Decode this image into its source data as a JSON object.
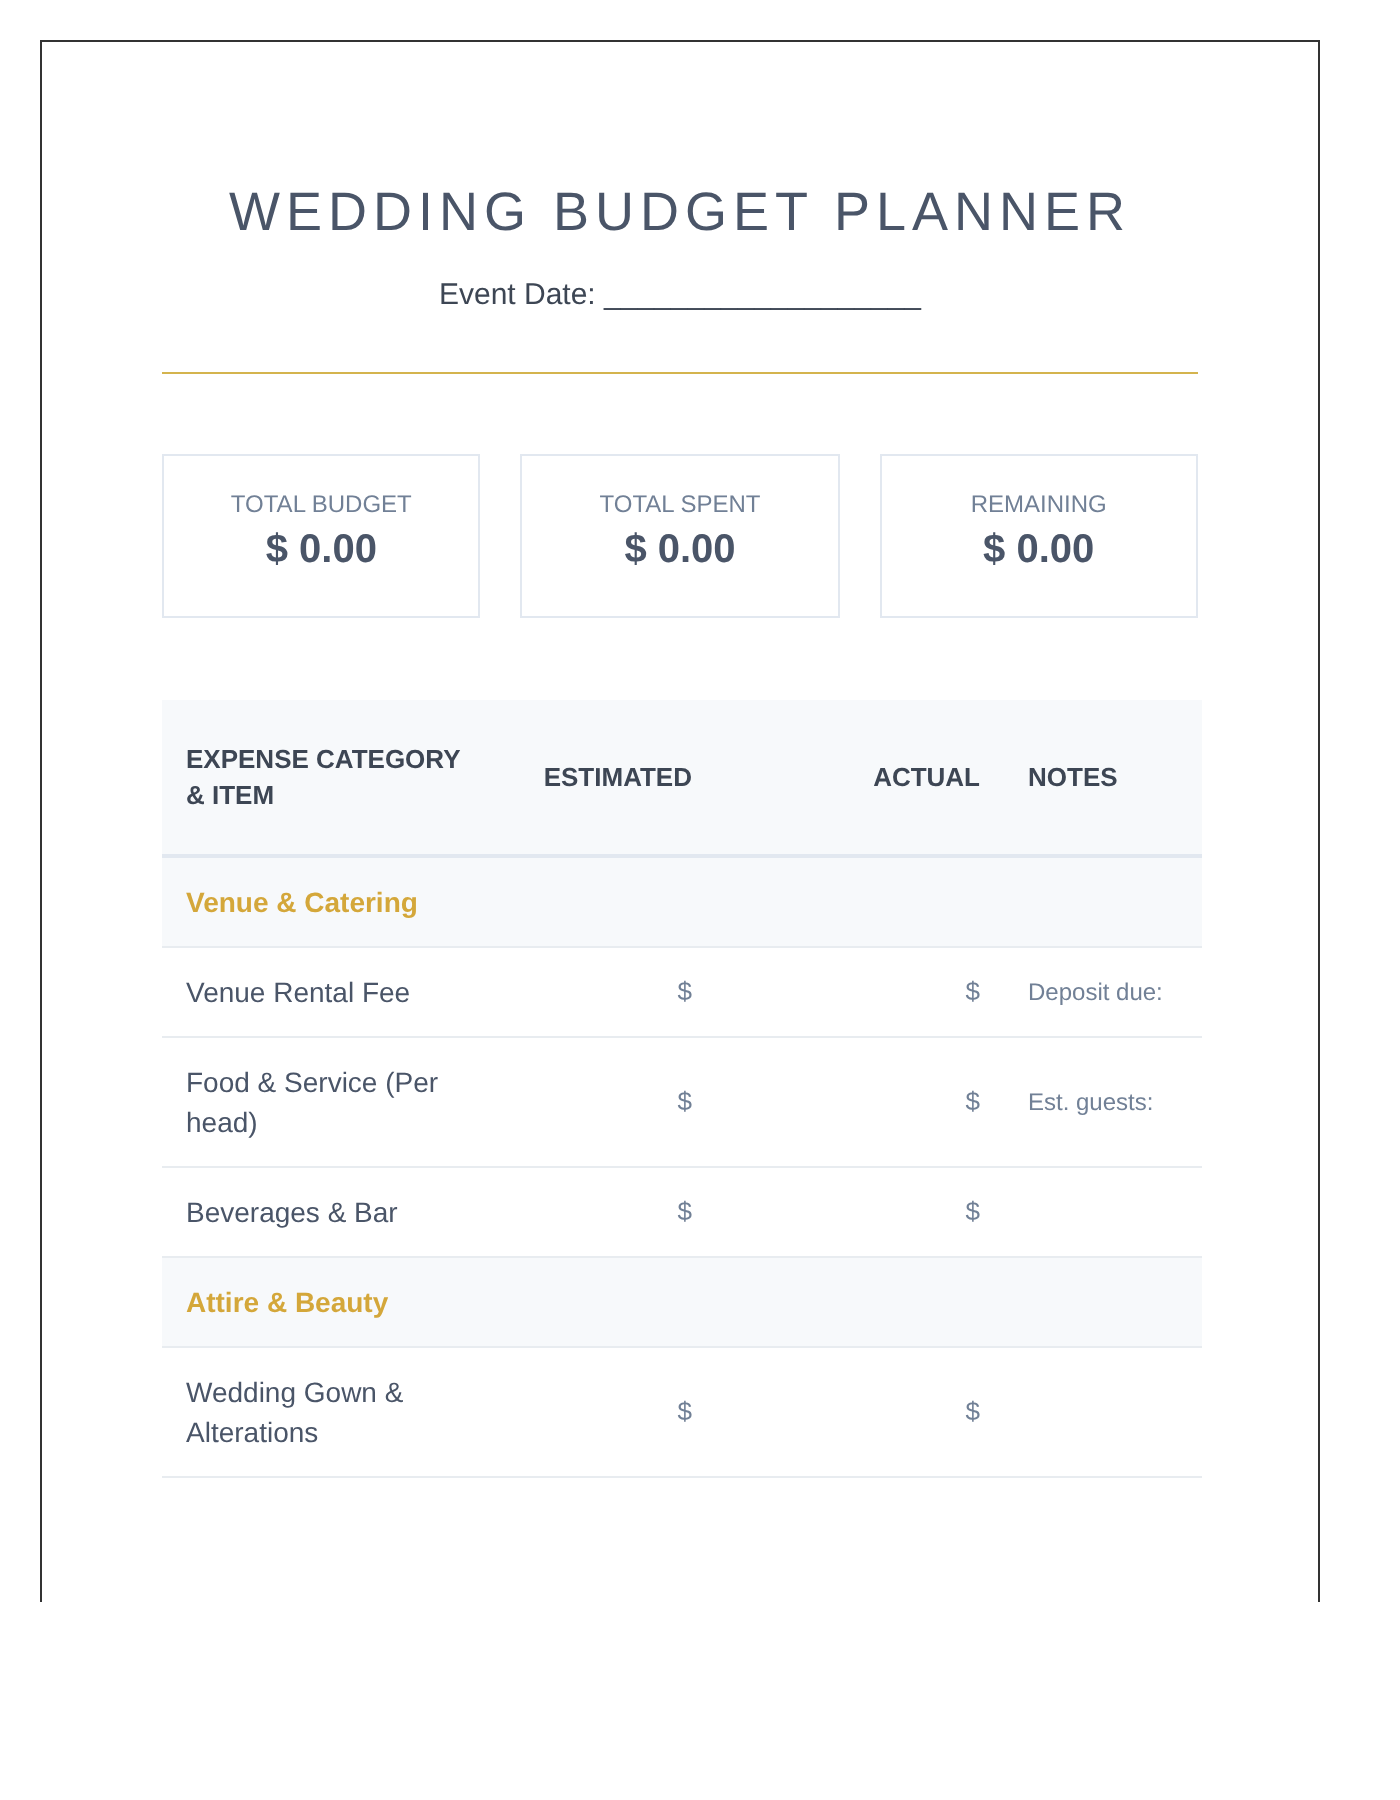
{
  "title": "WEDDING BUDGET PLANNER",
  "event_date": "Event Date: ___________________",
  "summary": [
    {
      "label": "TOTAL BUDGET",
      "value": "$ 0.00"
    },
    {
      "label": "TOTAL SPENT",
      "value": "$ 0.00"
    },
    {
      "label": "REMAINING",
      "value": "$ 0.00"
    }
  ],
  "table": {
    "columns": [
      "EXPENSE CATEGORY & ITEM",
      "ESTIMATED",
      "ACTUAL",
      "NOTES"
    ],
    "rows": [
      {
        "kind": "category",
        "label": "Venue & Catering"
      },
      {
        "kind": "item",
        "label": "Venue Rental Fee",
        "estimated": "$",
        "actual": "$",
        "notes": "Deposit due:"
      },
      {
        "kind": "item",
        "label": "Food & Service (Per head)",
        "estimated": "$",
        "actual": "$",
        "notes": "Est. guests:"
      },
      {
        "kind": "item",
        "label": "Beverages & Bar",
        "estimated": "$",
        "actual": "$"
      },
      {
        "kind": "category",
        "label": "Attire & Beauty"
      },
      {
        "kind": "item",
        "label": "Wedding Gown & Alterations",
        "estimated": "$",
        "actual": "$"
      }
    ]
  }
}
